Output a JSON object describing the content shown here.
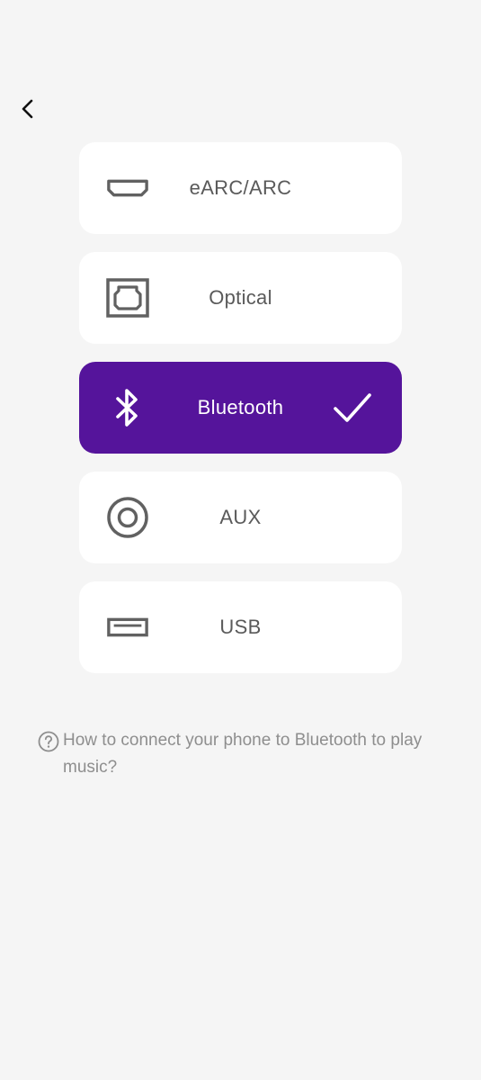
{
  "nav": {
    "back_icon": "chevron-left-icon"
  },
  "sources": [
    {
      "label": "eARC/ARC",
      "icon": "hdmi-port-icon",
      "selected": false
    },
    {
      "label": "Optical",
      "icon": "optical-port-icon",
      "selected": false
    },
    {
      "label": "Bluetooth",
      "icon": "bluetooth-icon",
      "selected": true
    },
    {
      "label": "AUX",
      "icon": "aux-port-icon",
      "selected": false
    },
    {
      "label": "USB",
      "icon": "usb-port-icon",
      "selected": false
    }
  ],
  "help": {
    "icon": "help-circle-icon",
    "text": "How to connect your phone to Bluetooth to play music?"
  },
  "colors": {
    "background": "#f5f5f5",
    "card": "#ffffff",
    "selected_card": "#55149b",
    "icon_gray": "#616161",
    "label_gray": "#5a5a5a",
    "help_gray": "#8e8e8e"
  }
}
